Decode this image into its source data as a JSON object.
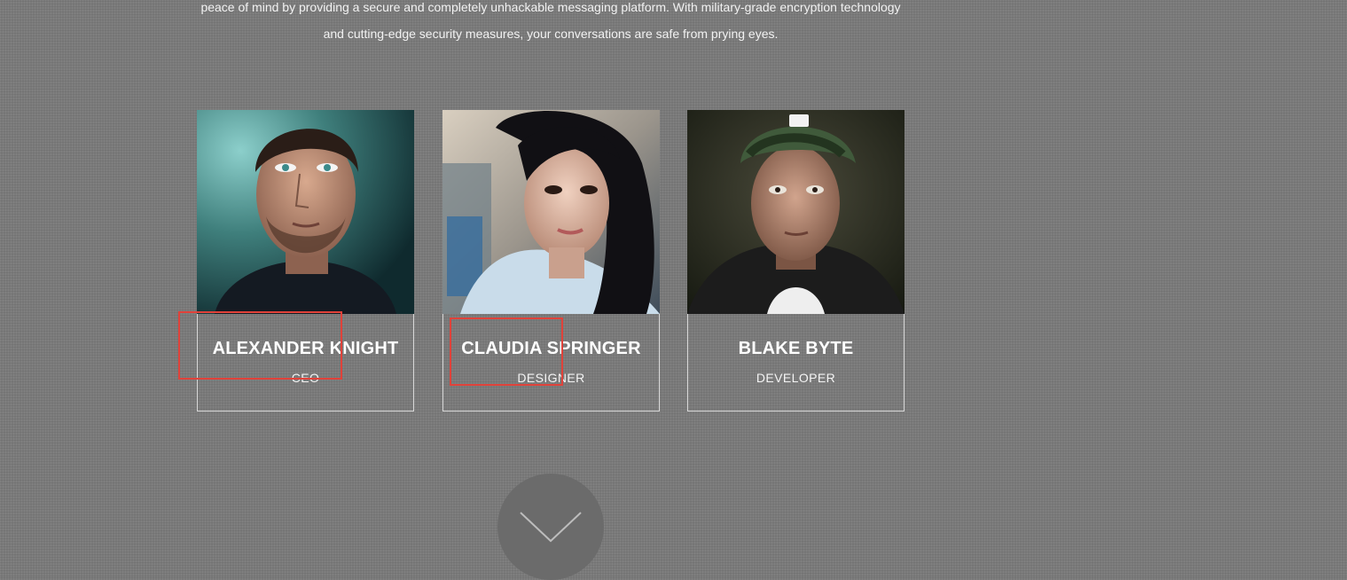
{
  "intro": {
    "line1": "peace of mind by providing a secure and completely unhackable messaging platform. With military-grade encryption technology",
    "line2": "and cutting-edge security measures, your conversations are safe from prying eyes."
  },
  "team": [
    {
      "name": "ALEXANDER KNIGHT",
      "role": "CEO"
    },
    {
      "name": "CLAUDIA SPRINGER",
      "role": "DESIGNER"
    },
    {
      "name": "BLAKE BYTE",
      "role": "DEVELOPER"
    }
  ],
  "scroll_button": {
    "icon": "chevron-down-icon"
  },
  "colors": {
    "background": "#7a7a7a",
    "highlight": "#e0423a",
    "card_border": "#d8d8d8"
  }
}
